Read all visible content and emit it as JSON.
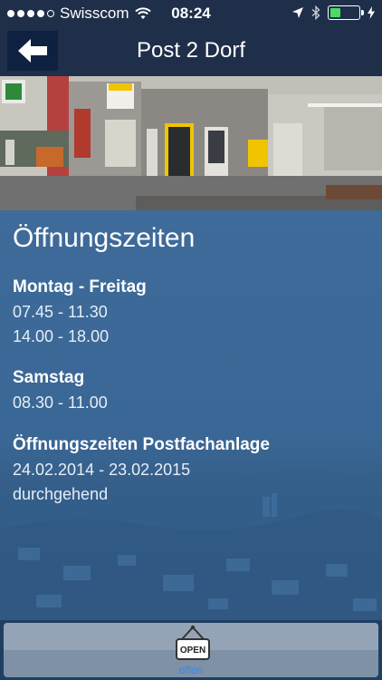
{
  "status_bar": {
    "carrier": "Swisscom",
    "time": "08:24",
    "signal_bars": 4,
    "battery_level": 0.35,
    "icons": [
      "wifi-icon",
      "location-arrow-icon",
      "bluetooth-icon",
      "battery-icon",
      "charging-icon"
    ]
  },
  "nav": {
    "title": "Post 2 Dorf",
    "back_icon": "arrow-left-icon"
  },
  "photo": {
    "description_icon": "post-office-photo"
  },
  "content": {
    "heading": "Öffnungszeiten",
    "sections": [
      {
        "title": "Montag - Freitag",
        "lines": [
          "07.45 - 11.30",
          "14.00 - 18.00"
        ]
      },
      {
        "title": "Samstag",
        "lines": [
          "08.30 - 11.00"
        ]
      },
      {
        "title": "Öffnungszeiten Postfachanlage",
        "lines": [
          "24.02.2014 - 23.02.2015",
          "durchgehend"
        ]
      }
    ]
  },
  "tabbar": {
    "sign_text": "OPEN",
    "label": "offen"
  },
  "colors": {
    "bar": "#1f2f4a",
    "content": "#3e6b9a",
    "tab_label": "#3a88e0"
  }
}
